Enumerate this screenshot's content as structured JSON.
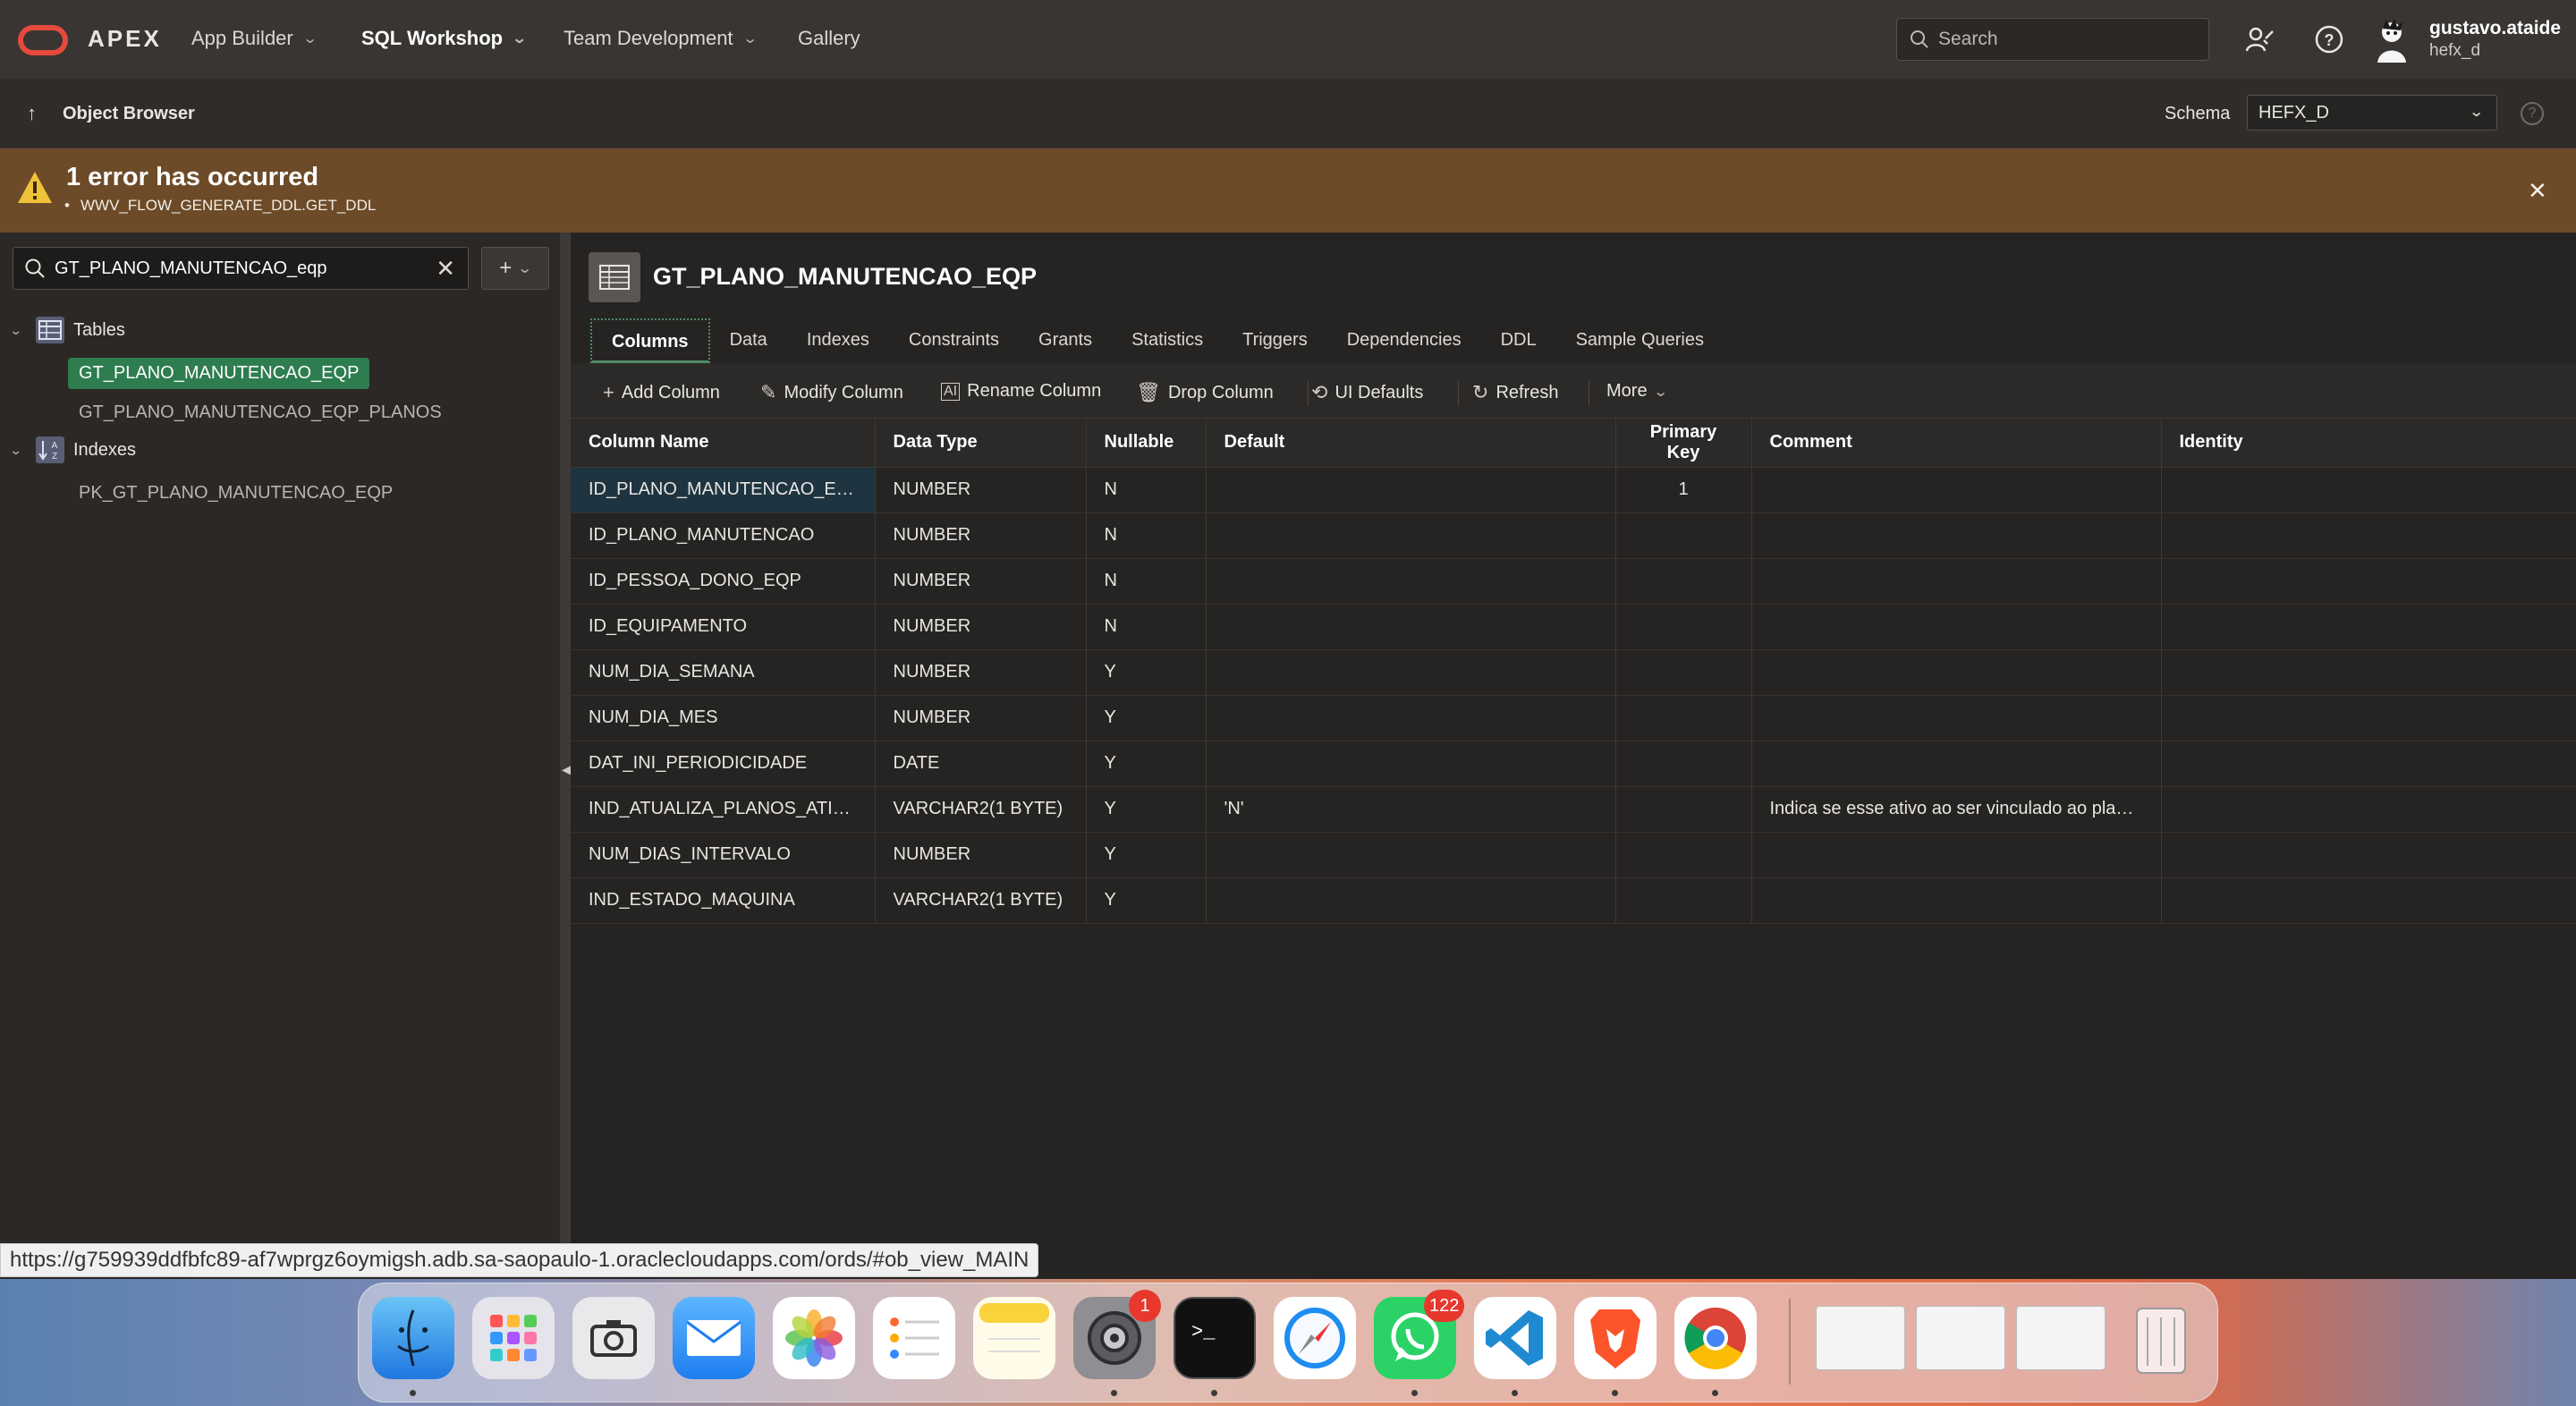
{
  "header": {
    "logo_text": "APEX",
    "nav": [
      {
        "label": "App Builder"
      },
      {
        "label": "SQL Workshop"
      },
      {
        "label": "Team Development"
      },
      {
        "label": "Gallery"
      }
    ],
    "search_placeholder": "Search",
    "user_name": "gustavo.ataide",
    "user_schema": "hefx_d"
  },
  "breadcrumb": {
    "label": "Object Browser",
    "schema_label": "Schema",
    "schema_value": "HEFX_D"
  },
  "error": {
    "title": "1 error has occurred",
    "detail": "WWV_FLOW_GENERATE_DDL.GET_DDL"
  },
  "sidebar": {
    "filter_value": "GT_PLANO_MANUTENCAO_eqp",
    "groups": [
      {
        "label": "Tables",
        "items": [
          "GT_PLANO_MANUTENCAO_EQP",
          "GT_PLANO_MANUTENCAO_EQP_PLANOS"
        ]
      },
      {
        "label": "Indexes",
        "items": [
          "PK_GT_PLANO_MANUTENCAO_EQP"
        ]
      }
    ]
  },
  "object": {
    "title": "GT_PLANO_MANUTENCAO_EQP",
    "tabs": [
      "Columns",
      "Data",
      "Indexes",
      "Constraints",
      "Grants",
      "Statistics",
      "Triggers",
      "Dependencies",
      "DDL",
      "Sample Queries"
    ],
    "toolbar": [
      "Add Column",
      "Modify Column",
      "Rename Column",
      "Drop Column",
      "UI Defaults",
      "Refresh",
      "More"
    ],
    "columns_header": [
      "Column Name",
      "Data Type",
      "Nullable",
      "Default",
      "Primary Key",
      "Comment",
      "Identity"
    ],
    "rows": [
      [
        "ID_PLANO_MANUTENCAO_EQP",
        "NUMBER",
        "N",
        "",
        "1",
        "",
        ""
      ],
      [
        "ID_PLANO_MANUTENCAO",
        "NUMBER",
        "N",
        "",
        "",
        "",
        ""
      ],
      [
        "ID_PESSOA_DONO_EQP",
        "NUMBER",
        "N",
        "",
        "",
        "",
        ""
      ],
      [
        "ID_EQUIPAMENTO",
        "NUMBER",
        "N",
        "",
        "",
        "",
        ""
      ],
      [
        "NUM_DIA_SEMANA",
        "NUMBER",
        "Y",
        "",
        "",
        "",
        ""
      ],
      [
        "NUM_DIA_MES",
        "NUMBER",
        "Y",
        "",
        "",
        "",
        ""
      ],
      [
        "DAT_INI_PERIODICIDADE",
        "DATE",
        "Y",
        "",
        "",
        "",
        ""
      ],
      [
        "IND_ATUALIZA_PLANOS_ATIVOS",
        "VARCHAR2(1 BYTE)",
        "Y",
        "'N'",
        "",
        "Indica se esse ativo ao ser vinculado ao plano ...",
        ""
      ],
      [
        "NUM_DIAS_INTERVALO",
        "NUMBER",
        "Y",
        "",
        "",
        "",
        ""
      ],
      [
        "IND_ESTADO_MAQUINA",
        "VARCHAR2(1 BYTE)",
        "Y",
        "",
        "",
        "",
        ""
      ]
    ]
  },
  "status_url": "https://g759939ddfbfc89-af7wprgz6oymigsh.adb.sa-saopaulo-1.oraclecloudapps.com/ords/#ob_view_MAIN",
  "dock": {
    "apps": [
      "finder-icon",
      "launchpad-icon",
      "screenshot-icon",
      "mail-icon",
      "photos-icon",
      "reminders-icon",
      "notes-icon",
      "system-settings-icon",
      "terminal-icon",
      "safari-icon",
      "whatsapp-icon",
      "vscode-icon",
      "brave-icon",
      "chrome-icon"
    ],
    "badges": {
      "system_settings": "1",
      "whatsapp": "122"
    }
  },
  "colors": {
    "accent": "#2e7d4f",
    "error_banner": "#6d4b28",
    "logo": "#e64a3c"
  }
}
